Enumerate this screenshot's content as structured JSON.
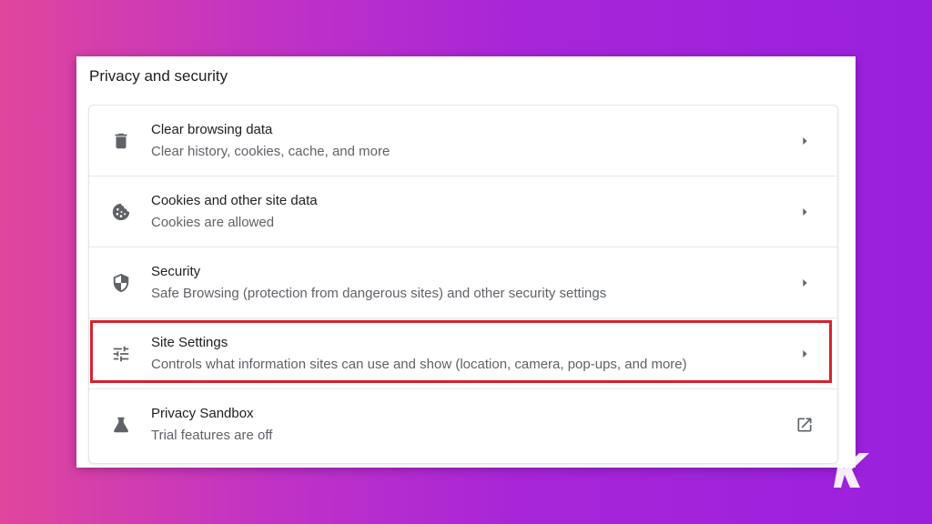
{
  "section": {
    "title": "Privacy and security"
  },
  "items": [
    {
      "title": "Clear browsing data",
      "subtitle": "Clear history, cookies, cache, and more",
      "icon": "trash-icon",
      "action_icon": "chevron-right-icon"
    },
    {
      "title": "Cookies and other site data",
      "subtitle": "Cookies are allowed",
      "icon": "cookie-icon",
      "action_icon": "chevron-right-icon"
    },
    {
      "title": "Security",
      "subtitle": "Safe Browsing (protection from dangerous sites) and other security settings",
      "icon": "shield-icon",
      "action_icon": "chevron-right-icon"
    },
    {
      "title": "Site Settings",
      "subtitle": "Controls what information sites can use and show (location, camera, pop-ups, and more)",
      "icon": "sliders-icon",
      "action_icon": "chevron-right-icon",
      "highlighted": true
    },
    {
      "title": "Privacy Sandbox",
      "subtitle": "Trial features are off",
      "icon": "flask-icon",
      "action_icon": "external-link-icon"
    }
  ],
  "colors": {
    "highlight_border": "#d8212f",
    "background_gradient_start": "#e0469c",
    "background_gradient_end": "#9a20de"
  },
  "watermark": {
    "text": "K"
  }
}
